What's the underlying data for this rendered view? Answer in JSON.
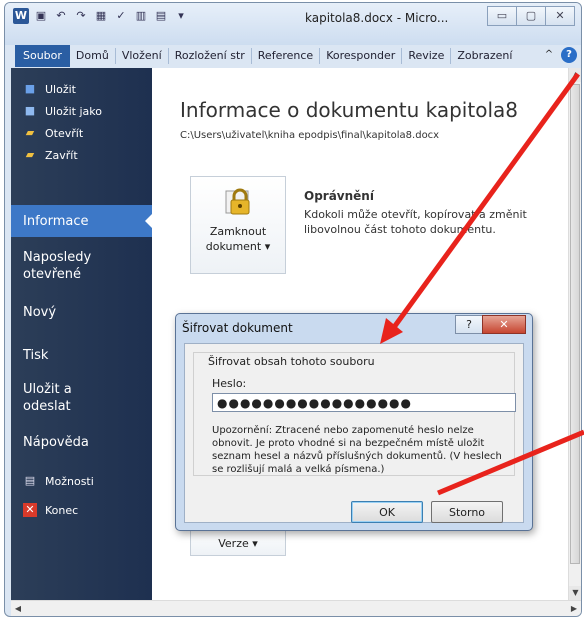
{
  "window": {
    "title": "kapitola8.docx - Micro...",
    "minimize": "▭",
    "maximize": "▢",
    "close": "✕"
  },
  "qat": {
    "app_icon": "W",
    "save_icon": "save-icon",
    "undo": "↶",
    "redo": "↷"
  },
  "tabs": {
    "file": "Soubor",
    "items": [
      "Domů",
      "Vložení",
      "Rozložení str",
      "Reference",
      "Koresponder",
      "Revize",
      "Zobrazení"
    ],
    "collapse": "^",
    "help": "?"
  },
  "sidebar": {
    "save": "Uložit",
    "save_as": "Uložit jako",
    "open": "Otevřít",
    "close": "Zavřít",
    "info": "Informace",
    "recent_line1": "Naposledy",
    "recent_line2": "otevřené",
    "new": "Nový",
    "print": "Tisk",
    "send_line1": "Uložit a",
    "send_line2": "odeslat",
    "help": "Nápověda",
    "options": "Možnosti",
    "exit": "Konec"
  },
  "main": {
    "title": "Informace o dokumentu kapitola8",
    "path": "C:\\Users\\uživatel\\kniha epodpis\\final\\kapitola8.docx",
    "protect_btn_line1": "Zamknout",
    "protect_btn_line2": "dokument ▾",
    "perm_heading": "Oprávnění",
    "perm_desc": "Kdokoli může otevřít, kopírovat a změnit libovolnou část tohoto dokumentu.",
    "versions_btn": "Verze ▾"
  },
  "dialog": {
    "title": "Šifrovat dokument",
    "help_btn": "?",
    "close_btn": "✕",
    "group_label": "Šifrovat obsah tohoto souboru",
    "password_label": "Heslo:",
    "password_value": "●●●●●●●●●●●●●●●●●",
    "warning": "Upozornění: Ztracené nebo zapomenuté heslo nelze obnovit. Je proto vhodné si na bezpečném místě uložit seznam hesel a názvů příslušných dokumentů. (V heslech se rozlišují malá a velká písmena.)",
    "ok": "OK",
    "cancel": "Storno"
  },
  "scroll": {
    "up": "▲",
    "down": "▼",
    "left": "◀",
    "right": "▶"
  },
  "colors": {
    "accent": "#2a5ea3",
    "sidebar": "#1e3050",
    "arrow": "#e8231c"
  }
}
